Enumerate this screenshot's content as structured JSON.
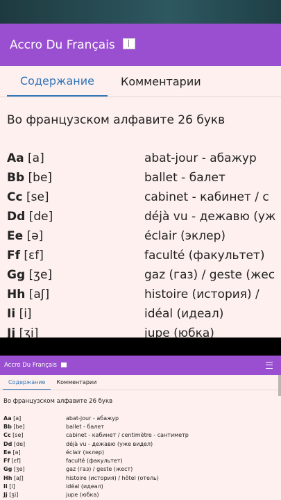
{
  "app": {
    "title": "Accro Du Français"
  },
  "tabs": [
    "Содержание",
    "Комментарии"
  ],
  "intro": "Во французском алфавите 26 букв",
  "zoom_rows": [
    {
      "letter": "Aa",
      "ipa": "[a]",
      "word": "abat-jour - абажур"
    },
    {
      "letter": "Bb",
      "ipa": "[be]",
      "word": "ballet - балет"
    },
    {
      "letter": "Cc",
      "ipa": "[se]",
      "word": "cabinet - кабинет / c"
    },
    {
      "letter": "Dd",
      "ipa": "[de]",
      "word": "déjà vu - дежавю (уж"
    },
    {
      "letter": "Ee",
      "ipa": "[ə]",
      "word": "éclair (эклер)"
    },
    {
      "letter": "Ff",
      "ipa": "[ɛf]",
      "word": "faculté (факультет)"
    },
    {
      "letter": "Gg",
      "ipa": "[ʒe]",
      "word": "gaz (газ) / geste (жес"
    },
    {
      "letter": "Hh",
      "ipa": "[aʃ]",
      "word": "histoire (история) /"
    },
    {
      "letter": "Ii",
      "ipa": "[i]",
      "word": "idéal (идеал)"
    },
    {
      "letter": "Jj",
      "ipa": "[ʒi]",
      "word": "jupe (юбка)"
    }
  ],
  "mini_rows": [
    {
      "letter": "Aa",
      "ipa": "[a]",
      "word": "abat-jour - абажур"
    },
    {
      "letter": "Bb",
      "ipa": "[be]",
      "word": "ballet - балет"
    },
    {
      "letter": "Cc",
      "ipa": "[se]",
      "word": "cabinet - кабинет / centimètre - сантиметр"
    },
    {
      "letter": "Dd",
      "ipa": "[de]",
      "word": "déjà vu - дежавю (уже видел)"
    },
    {
      "letter": "Ee",
      "ipa": "[ə]",
      "word": "éclair (эклер)"
    },
    {
      "letter": "Ff",
      "ipa": "[ɛf]",
      "word": "faculté (факультет)"
    },
    {
      "letter": "Gg",
      "ipa": "[ʒe]",
      "word": "gaz (газ) / geste (жест)"
    },
    {
      "letter": "Hh",
      "ipa": "[aʃ]",
      "word": "histoire (история) / hôtel (отель)"
    },
    {
      "letter": "Ii",
      "ipa": "[i]",
      "word": "idéal (идеал)"
    },
    {
      "letter": "Jj",
      "ipa": "[ʒi]",
      "word": "jupe (юбка)"
    }
  ],
  "icons": {
    "title_icon": "book-icon",
    "menu": "hamburger-menu-icon"
  },
  "colors": {
    "appbar": "#9a4fd0",
    "accent": "#3275b8",
    "background": "#fdf0ee"
  }
}
